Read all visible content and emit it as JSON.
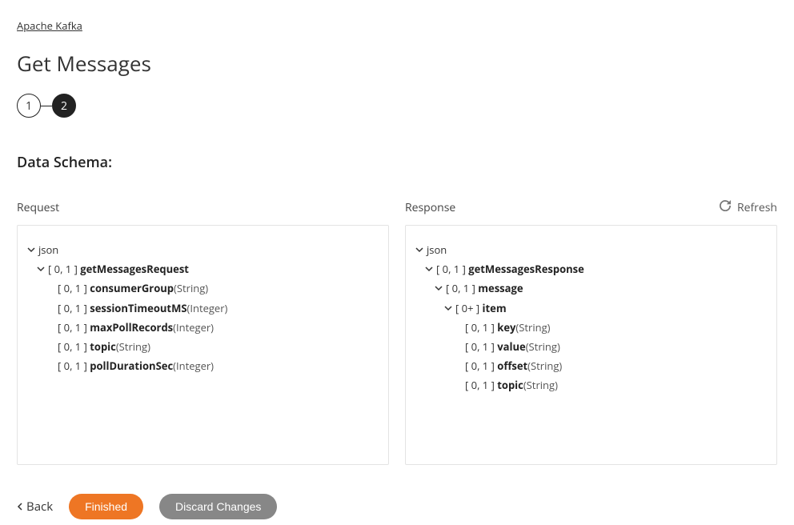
{
  "breadcrumb": "Apache Kafka",
  "page_title": "Get Messages",
  "stepper": {
    "step1": "1",
    "step2": "2"
  },
  "section_title": "Data Schema:",
  "refresh_label": "Refresh",
  "request_label": "Request",
  "response_label": "Response",
  "request_tree": {
    "root": "json",
    "lvl1_prefix": "[ 0, 1 ]",
    "lvl1_name": "getMessagesRequest",
    "children": [
      {
        "prefix": "[ 0, 1 ]",
        "name": "consumerGroup",
        "type": "(String)"
      },
      {
        "prefix": "[ 0, 1 ]",
        "name": "sessionTimeoutMS",
        "type": "(Integer)"
      },
      {
        "prefix": "[ 0, 1 ]",
        "name": "maxPollRecords",
        "type": "(Integer)"
      },
      {
        "prefix": "[ 0, 1 ]",
        "name": "topic",
        "type": "(String)"
      },
      {
        "prefix": "[ 0, 1 ]",
        "name": "pollDurationSec",
        "type": "(Integer)"
      }
    ]
  },
  "response_tree": {
    "root": "json",
    "lvl1_prefix": "[ 0, 1 ]",
    "lvl1_name": "getMessagesResponse",
    "lvl2_prefix": "[ 0, 1 ]",
    "lvl2_name": "message",
    "lvl3_prefix": "[ 0+ ]",
    "lvl3_name": "item",
    "children": [
      {
        "prefix": "[ 0, 1 ]",
        "name": "key",
        "type": "(String)"
      },
      {
        "prefix": "[ 0, 1 ]",
        "name": "value",
        "type": "(String)"
      },
      {
        "prefix": "[ 0, 1 ]",
        "name": "offset",
        "type": "(String)"
      },
      {
        "prefix": "[ 0, 1 ]",
        "name": "topic",
        "type": "(String)"
      }
    ]
  },
  "footer": {
    "back": "Back",
    "finished": "Finished",
    "discard": "Discard Changes"
  }
}
